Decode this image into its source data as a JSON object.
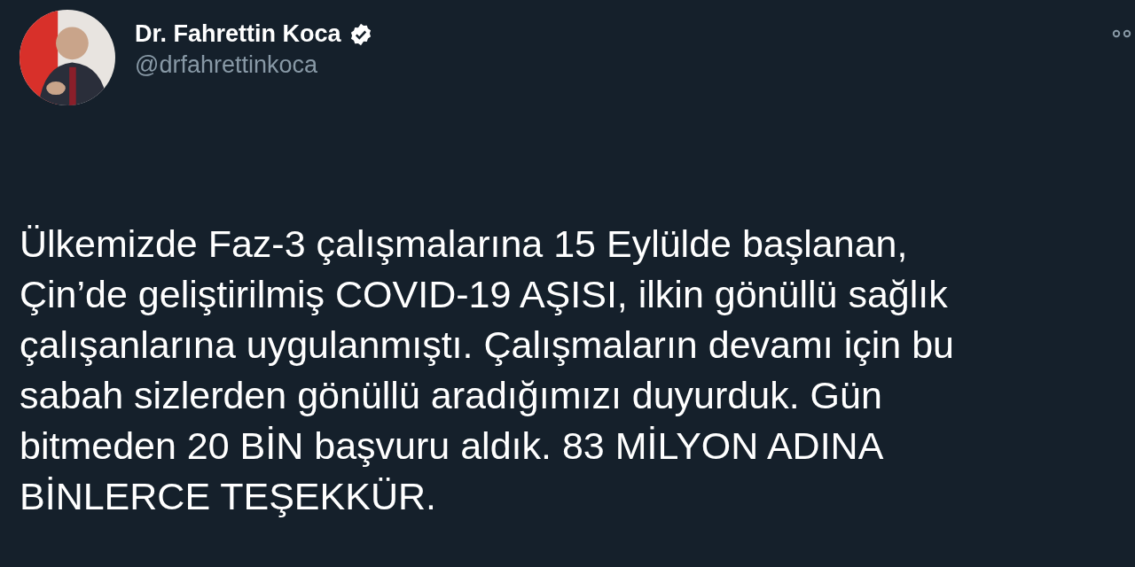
{
  "author": {
    "name": "Dr. Fahrettin Koca",
    "verified": true,
    "handle": "@drfahrettinkoca"
  },
  "tweet": {
    "text": "Ülkemizde Faz-3 çalışmalarına 15 Eylülde başlanan,\nÇin’de geliştirilmiş COVID-19 AŞISI, ilkin gönüllü sağlık\nçalışanlarına uygulanmıştı. Çalışmaların devamı için bu\nsabah sizlerden gönüllü aradığımızı duyurduk. Gün\nbitmeden 20 BİN başvuru aldık. 83 MİLYON ADINA\nBİNLERCE TEŞEKKÜR."
  }
}
